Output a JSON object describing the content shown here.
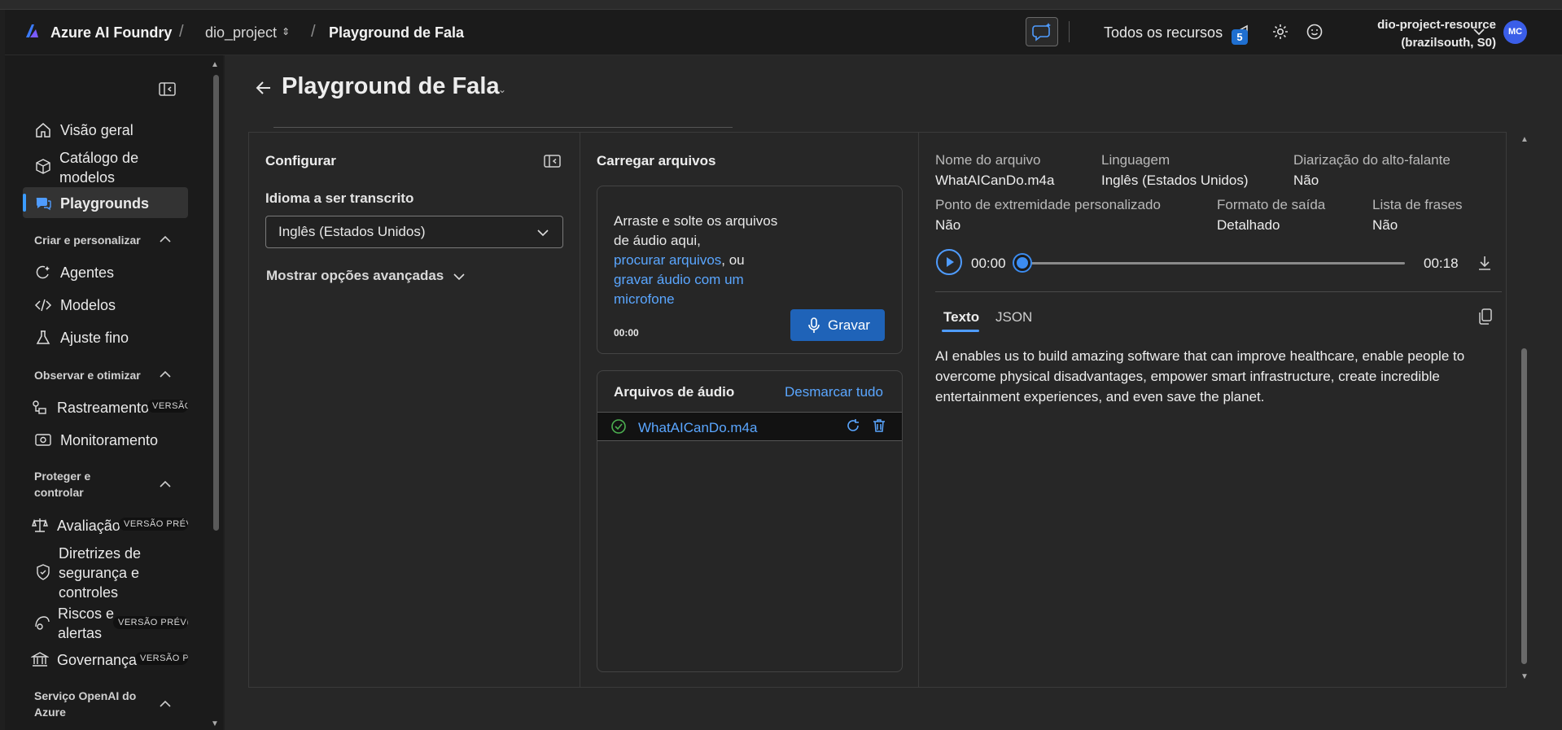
{
  "header": {
    "brand": "Azure AI Foundry",
    "project": "dio_project",
    "page": "Playground de Fala",
    "all_resources": "Todos os recursos",
    "notifications_count": "5",
    "resource_name": "dio-project-resource",
    "resource_region": "(brazilsouth, S0)",
    "avatar_initials": "MC"
  },
  "sidebar": {
    "items": {
      "overview": "Visão geral",
      "catalog_line1": "Catálogo de",
      "catalog_line2": "modelos",
      "playgrounds": "Playgrounds",
      "agents": "Agentes",
      "models": "Modelos",
      "finetune": "Ajuste fino",
      "tracing": "Rastreamento",
      "monitoring": "Monitoramento",
      "evaluation": "Avaliação",
      "guardrails_line1": "Diretrizes de",
      "guardrails_line2": "segurança e",
      "guardrails_line3": "controles",
      "risks_line1": "Riscos e",
      "risks_line2": "alertas",
      "governance": "Governança"
    },
    "sections": {
      "create": "Criar e personalizar",
      "observe": "Observar e otimizar",
      "protect_line1": "Proteger e",
      "protect_line2": "controlar",
      "openai_line1": "Serviço OpenAI do",
      "openai_line2": "Azure"
    },
    "tags": {
      "tracing": "VERSÃO",
      "evaluation": "VERSÃO PRÉVIA",
      "risks": "VERSÃO PRÉVIA",
      "governance": "VERSÃO PR"
    }
  },
  "page": {
    "title": "Playground de Fala"
  },
  "configure": {
    "title": "Configurar",
    "language_label": "Idioma a ser transcrito",
    "language_value": "Inglês (Estados Unidos)",
    "advanced_options": "Mostrar opções avançadas"
  },
  "upload": {
    "title": "Carregar arquivos",
    "drop_text": "Arraste e solte os arquivos de áudio aqui,",
    "browse_link": "procurar arquivos",
    "or_text": ", ou",
    "record_link": "gravar áudio com um microfone",
    "timer": "00:00",
    "record_button": "Gravar"
  },
  "audio_files": {
    "title": "Arquivos de áudio",
    "unselect_all": "Desmarcar tudo",
    "files": [
      {
        "name": "WhatAICanDo.m4a"
      }
    ]
  },
  "result": {
    "file_name_label": "Nome do arquivo",
    "file_name_value": "WhatAICanDo.m4a",
    "language_label": "Linguagem",
    "language_value": "Inglês (Estados Unidos)",
    "diarization_label": "Diarização do alto-falante",
    "diarization_value": "Não",
    "endpoint_label": "Ponto de extremidade personalizado",
    "endpoint_value": "Não",
    "format_label": "Formato de saída",
    "format_value": "Detalhado",
    "phrases_label": "Lista de frases",
    "phrases_value": "Não",
    "time_start": "00:00",
    "time_end": "00:18",
    "playback_progress": 0.0,
    "tab_text": "Texto",
    "tab_json": "JSON",
    "transcript": "AI enables us to build amazing software that can improve healthcare, enable people to overcome physical disadvantages, empower smart infrastructure, create incredible entertainment experiences, and even save the planet."
  },
  "colors": {
    "accent": "#4f9cff",
    "link": "#5aa6ff",
    "primary_button": "#1f63b8",
    "avatar": "#3b5ee8"
  }
}
